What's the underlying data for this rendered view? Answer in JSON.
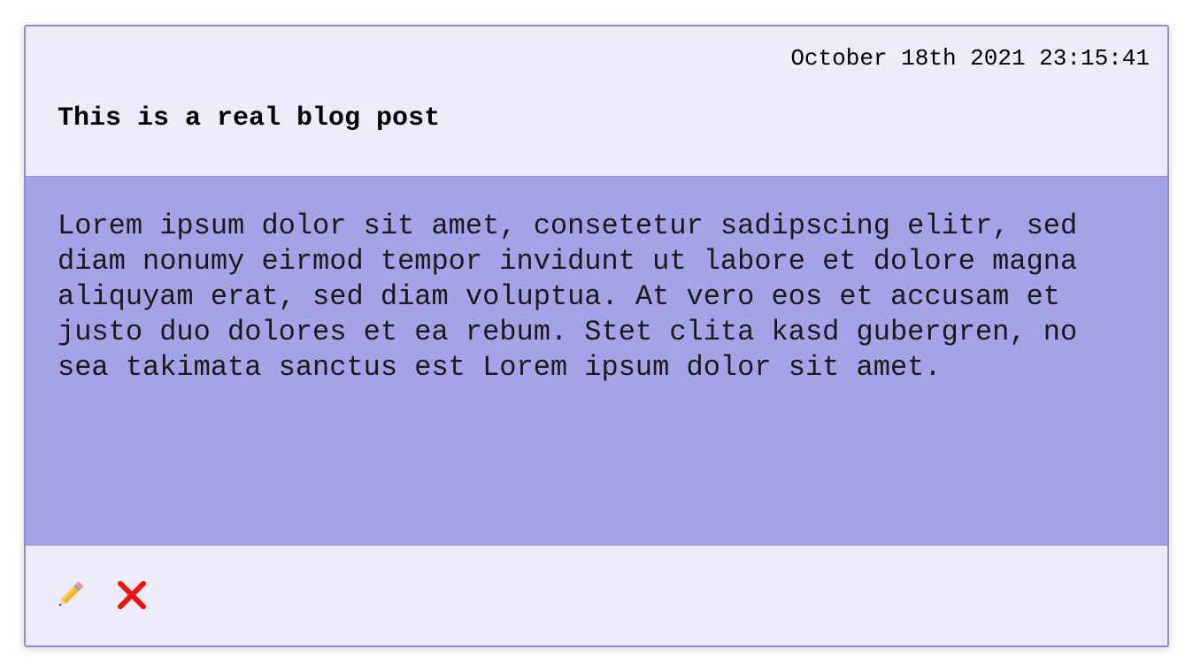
{
  "post": {
    "timestamp": "October 18th 2021 23:15:41",
    "title": "This is a real blog post",
    "body": "Lorem ipsum dolor sit amet, consetetur sadipscing elitr, sed diam nonumy eirmod tempor invidunt ut labore et dolore magna aliquyam erat, sed diam voluptua. At vero eos et accusam et justo duo dolores et ea rebum. Stet clita kasd gubergren, no sea takimata sanctus est Lorem ipsum dolor sit amet."
  },
  "actions": {
    "edit_icon": "pencil-icon",
    "delete_icon": "cross-mark-icon"
  },
  "colors": {
    "header_bg": "#ececf9",
    "body_bg": "#a6a2e8",
    "border": "#8e8ed6",
    "delete_red": "#ee1111"
  }
}
